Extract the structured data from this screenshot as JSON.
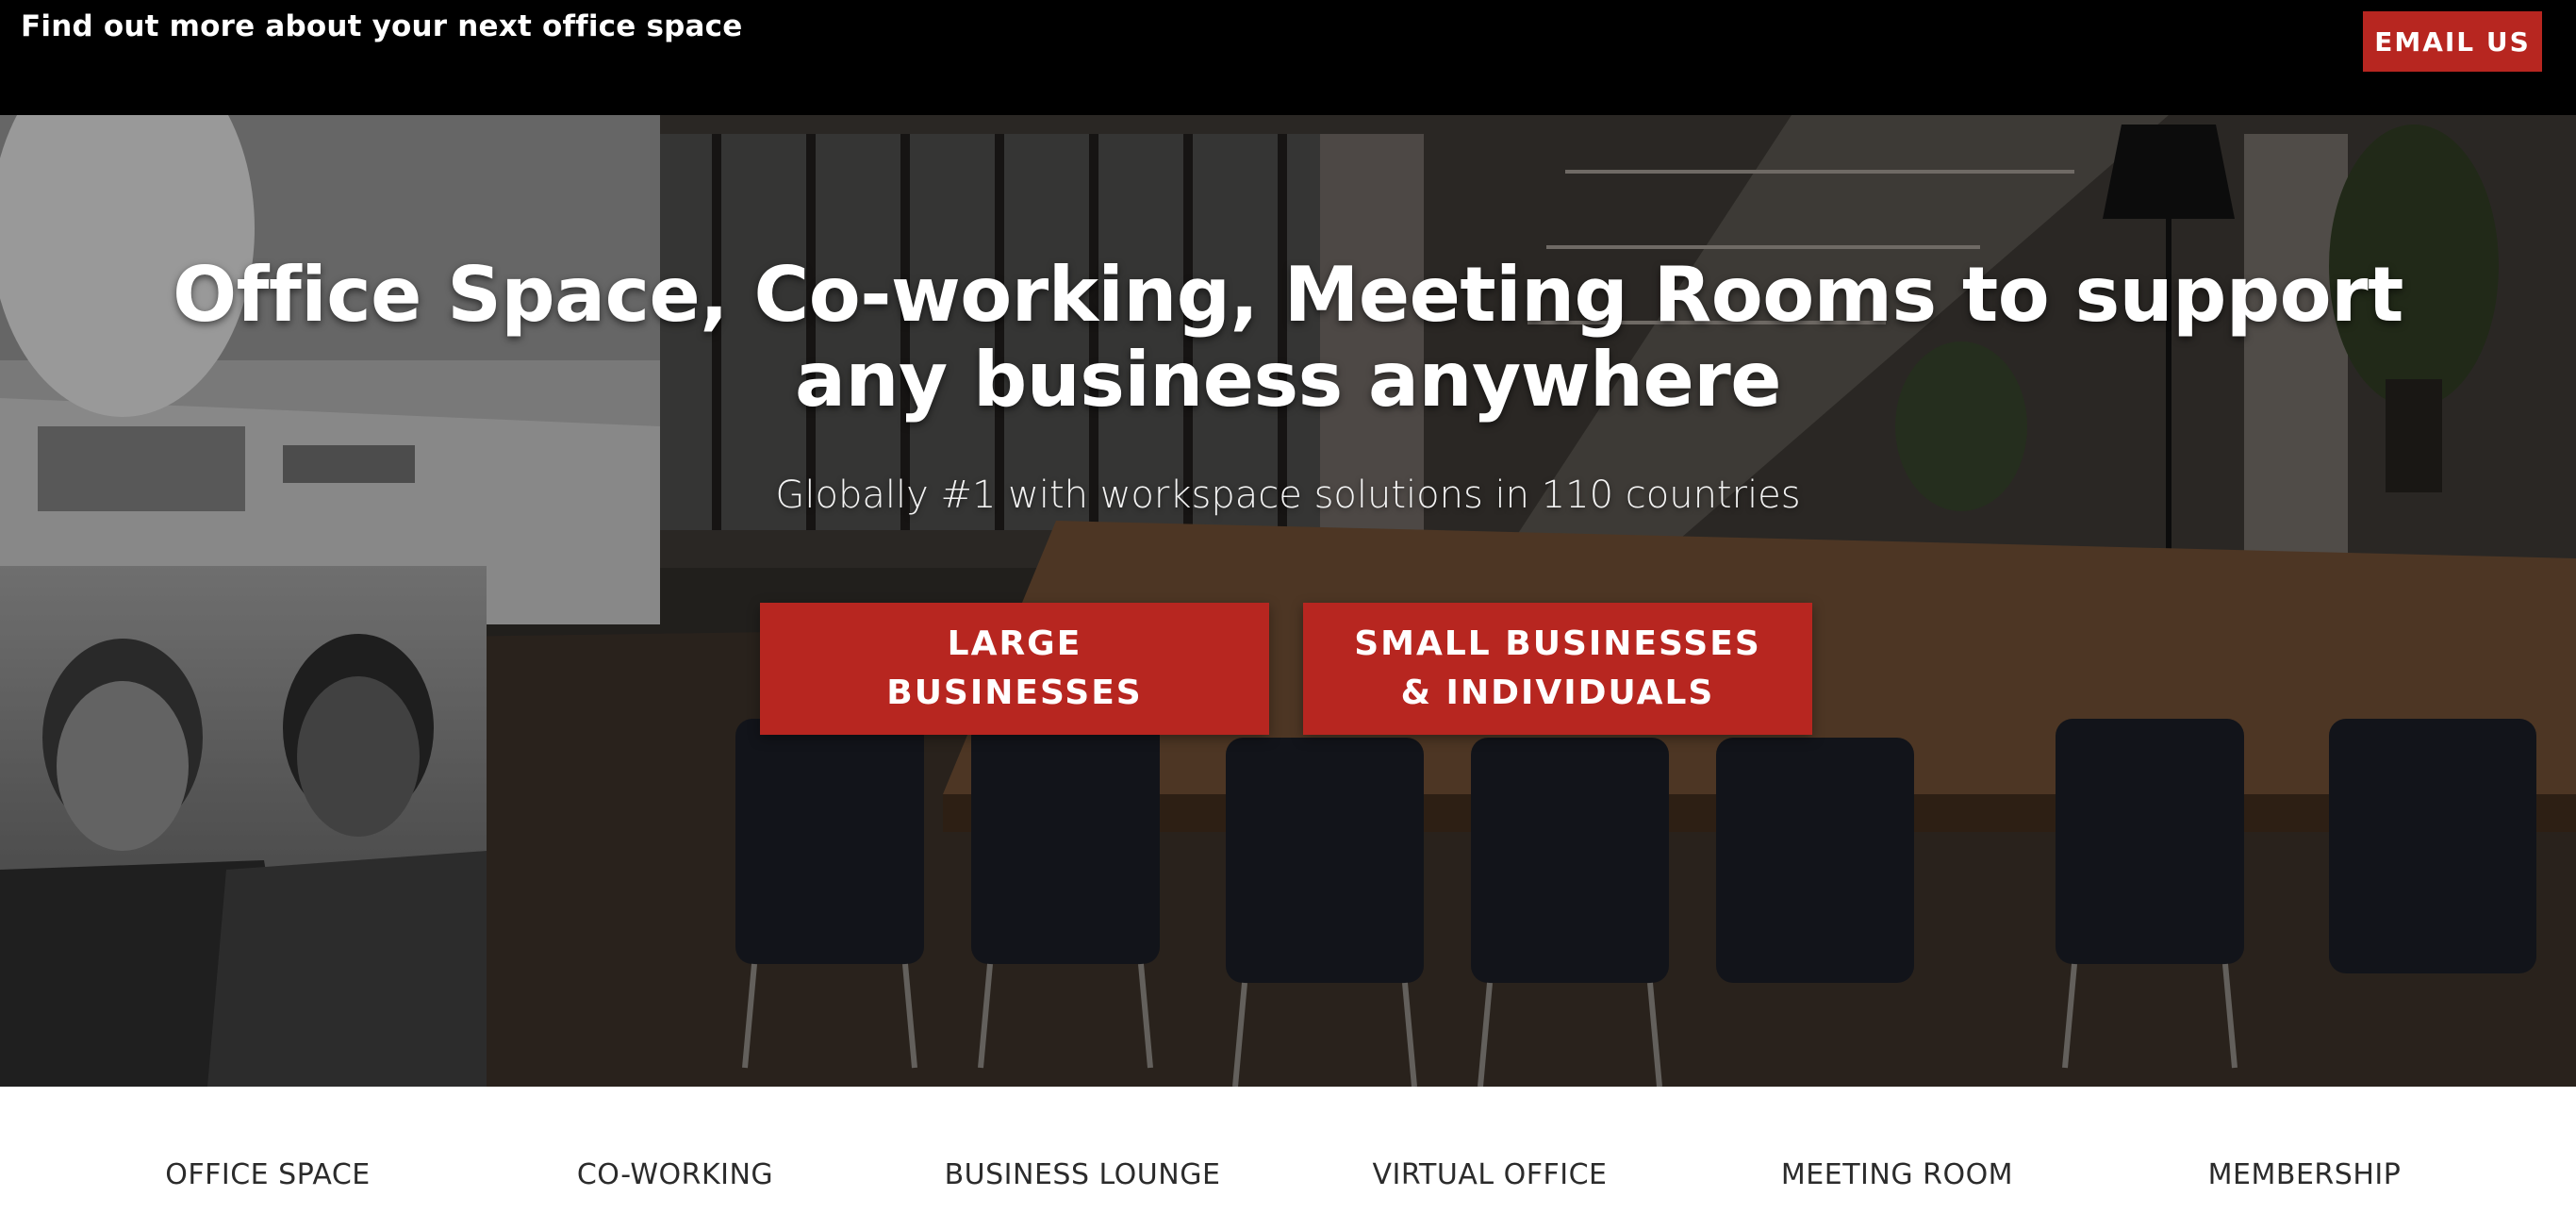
{
  "topbar": {
    "tagline": "Find out more about your next office space",
    "email_button": "EMAIL US"
  },
  "hero": {
    "title": "Office Space, Co-working, Meeting Rooms to support any business anywhere",
    "subtitle": "Globally #1 with workspace solutions in 110 countries",
    "cta_large": {
      "line1": "LARGE",
      "line2": "BUSINESSES"
    },
    "cta_small": {
      "line1": "SMALL BUSINESSES",
      "line2": "& INDIVIDUALS"
    }
  },
  "nav": {
    "items": [
      {
        "label": "OFFICE SPACE"
      },
      {
        "label": "CO-WORKING"
      },
      {
        "label": "BUSINESS LOUNGE"
      },
      {
        "label": "VIRTUAL OFFICE"
      },
      {
        "label": "MEETING ROOM"
      },
      {
        "label": "MEMBERSHIP"
      }
    ]
  },
  "colors": {
    "brand_red": "#b72620",
    "topbar_bg": "#000000",
    "nav_text": "#2b2b2b"
  }
}
